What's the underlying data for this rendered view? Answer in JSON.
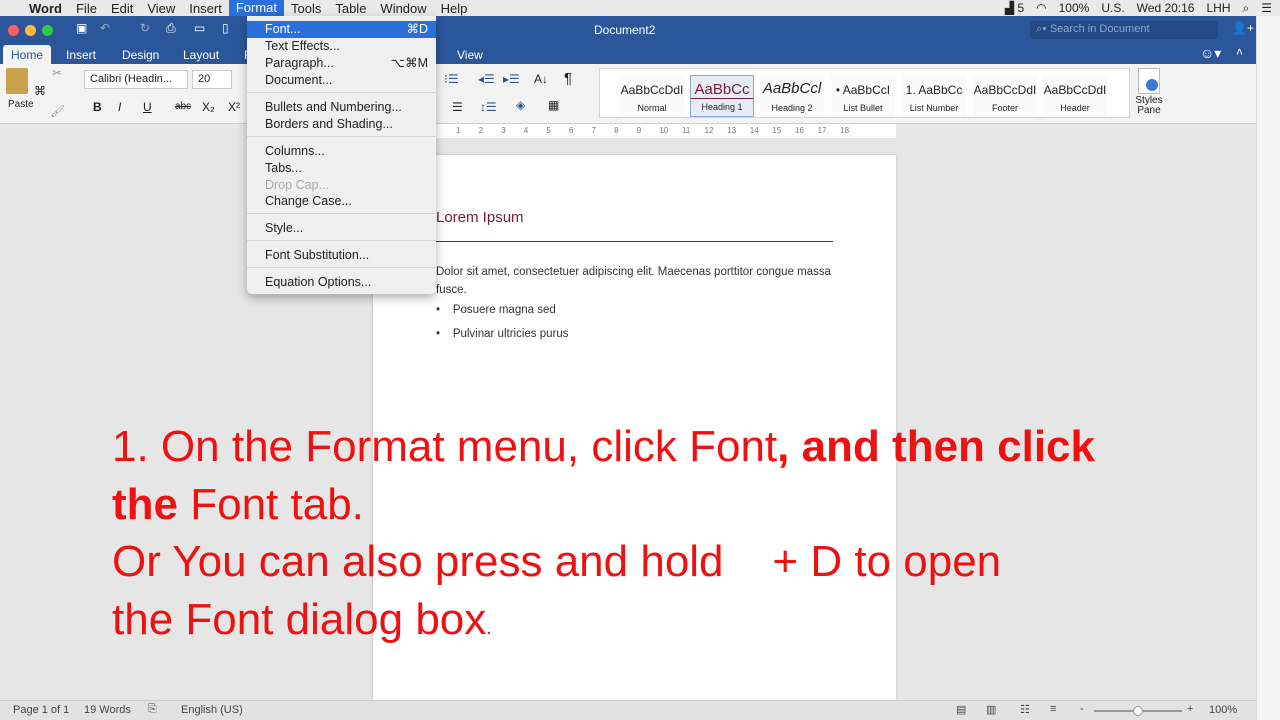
{
  "menubar": {
    "app": "Word",
    "items": [
      "File",
      "Edit",
      "View",
      "Insert",
      "Format",
      "Tools",
      "Table",
      "Window",
      "Help"
    ],
    "status": {
      "adobe": "5",
      "battery": "100%",
      "input": "U.S.",
      "clock": "Wed 20:16",
      "user": "LHH"
    }
  },
  "window": {
    "title": "Document2",
    "search_placeholder": "Search in Document"
  },
  "ribbon": {
    "tabs": [
      "Home",
      "Insert",
      "Design",
      "Layout",
      "R",
      "View"
    ],
    "active_tab": "Home",
    "paste": "Paste",
    "font": "Calibri (Headin...",
    "size": "20",
    "styles": [
      {
        "preview": "AaBbCcDdI",
        "name": "Normal"
      },
      {
        "preview": "AaBbCc",
        "name": "Heading 1"
      },
      {
        "preview": "AaBbCcl",
        "name": "Heading 2"
      },
      {
        "preview": "• AaBbCcI",
        "name": "List Bullet"
      },
      {
        "preview": "1. AaBbCc",
        "name": "List Number"
      },
      {
        "preview": "AaBbCcDdI",
        "name": "Footer"
      },
      {
        "preview": "AaBbCcDdI",
        "name": "Header"
      }
    ],
    "styles_pane": "Styles Pane"
  },
  "ruler": [
    "1",
    "2",
    "3",
    "4",
    "5",
    "6",
    "7",
    "8",
    "9",
    "10",
    "11",
    "12",
    "13",
    "14",
    "15",
    "16",
    "17",
    "18"
  ],
  "format_menu": [
    {
      "label": "Font...",
      "shortcut": "⌘D",
      "selected": true
    },
    {
      "label": "Text Effects..."
    },
    {
      "label": "Paragraph...",
      "shortcut": "⌥⌘M"
    },
    {
      "label": "Document..."
    },
    {
      "label": "Bullets and Numbering..."
    },
    {
      "label": "Borders and Shading..."
    },
    {
      "label": "Columns..."
    },
    {
      "label": "Tabs..."
    },
    {
      "label": "Drop Cap...",
      "disabled": true
    },
    {
      "label": "Change Case..."
    },
    {
      "label": "Style..."
    },
    {
      "label": "Font Substitution..."
    },
    {
      "label": "Equation Options..."
    }
  ],
  "document": {
    "heading": "Lorem Ipsum",
    "body": "Dolor sit amet, consectetuer adipiscing elit. Maecenas porttitor congue massa fusce.",
    "bullets": [
      "Posuere magna sed",
      "Pulvinar ultricies purus"
    ]
  },
  "overlay": {
    "l1a": "1. On the Format menu, click Font",
    "l1b": ", and then click",
    "l2a": "the",
    "l2b": " Font tab.",
    "l3": "Or You can also press and hold    + D to open",
    "l4": "the Font dialog box",
    "l4dot": "."
  },
  "statusbar": {
    "page": "Page 1 of 1",
    "words": "19 Words",
    "language": "English (US)",
    "zoom": "100%",
    "zoom_level": 100
  },
  "colors": {
    "accent": "#2b579a",
    "menu_highlight": "#2a6fdb",
    "overlay_text": "#ee1111",
    "heading": "#7b1c2e"
  }
}
